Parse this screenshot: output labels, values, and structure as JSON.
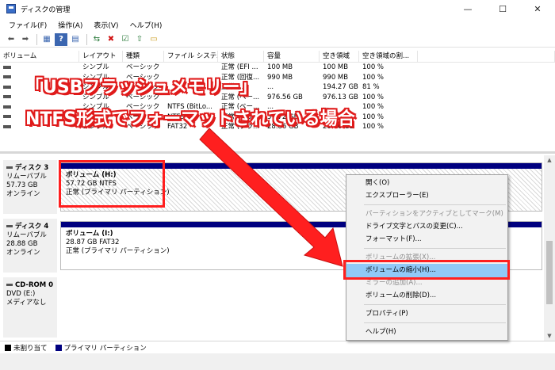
{
  "window": {
    "title": "ディスクの管理",
    "minimize_glyph": "—",
    "maximize_glyph": "☐",
    "close_glyph": "✕"
  },
  "menubar": {
    "items": [
      "ファイル(F)",
      "操作(A)",
      "表示(V)",
      "ヘルプ(H)"
    ]
  },
  "toolbar": {
    "icons": [
      "back-arrow-icon",
      "forward-arrow-icon",
      "console-icon",
      "help-icon",
      "properties-icon",
      "connect-icon",
      "delete-icon",
      "check-icon",
      "folder-up-icon",
      "folder-icon"
    ],
    "glyphs": [
      "⬅",
      "➡",
      "▦",
      "?",
      "▤",
      "⇆",
      "✖",
      "☑",
      "⇧",
      "▭"
    ]
  },
  "volume_table": {
    "headers": [
      "ボリューム",
      "レイアウト",
      "種類",
      "ファイル システム",
      "状態",
      "容量",
      "空き領域",
      "空き領域の割...",
      ""
    ],
    "rows": [
      [
        "",
        "シンプル",
        "ベーシック",
        "",
        "正常 (EFI ...",
        "100 MB",
        "100 MB",
        "100 %",
        ""
      ],
      [
        "",
        "シンプル",
        "ベーシック",
        "",
        "正常 (回復...",
        "990 MB",
        "990 MB",
        "100 %",
        ""
      ],
      [
        "",
        "シンプル",
        "ベーシック",
        "",
        "正常 (...",
        "...",
        "194.27 GB",
        "81 %",
        ""
      ],
      [
        "",
        "シンプル",
        "ベーシック",
        "",
        "正常 (ベー...",
        "976.56 GB",
        "976.13 GB",
        "100 %",
        ""
      ],
      [
        "",
        "シンプル",
        "ベーシック",
        "NTFS (BitLo...",
        "正常 (ベー...",
        "...",
        "...",
        "100 %",
        ""
      ],
      [
        "",
        "シンプル",
        "ベーシック",
        "NTFS",
        "正常 (プラ...",
        "57.72 GB",
        "57.59 GB",
        "100 %",
        ""
      ],
      [
        "",
        "シンプル",
        "ベーシック",
        "FAT32",
        "正常 (プラ...",
        "28.86 GB",
        "28.86 GB",
        "100 %",
        ""
      ]
    ]
  },
  "disks": [
    {
      "label_name": "ディスク 3",
      "label_type": "リムーバブル",
      "label_size": "57.73 GB",
      "label_status": "オンライン",
      "partition_name": "ボリューム (H:)",
      "partition_size": "57.72 GB NTFS",
      "partition_status": "正常 (プライマリ パーティション)"
    },
    {
      "label_name": "ディスク 4",
      "label_type": "リムーバブル",
      "label_size": "28.88 GB",
      "label_status": "オンライン",
      "partition_name": "ボリューム (I:)",
      "partition_size": "28.87 GB FAT32",
      "partition_status": "正常 (プライマリ パーティション)"
    },
    {
      "label_name": "CD-ROM 0",
      "label_type": "DVD (E:)",
      "label_size": "",
      "label_status": "メディアなし"
    }
  ],
  "legend": {
    "items": [
      {
        "label": "未割り当て",
        "color": "#000000"
      },
      {
        "label": "プライマリ パーティション",
        "color": "#00007f"
      }
    ]
  },
  "context_menu": {
    "items": [
      {
        "label": "開く(O)",
        "disabled": false,
        "highlight": false
      },
      {
        "label": "エクスプローラー(E)",
        "disabled": false,
        "highlight": false
      },
      {
        "label": "パーティションをアクティブとしてマーク(M)",
        "disabled": true,
        "highlight": false
      },
      {
        "label": "ドライブ文字とパスの変更(C)...",
        "disabled": false,
        "highlight": false
      },
      {
        "label": "フォーマット(F)...",
        "disabled": false,
        "highlight": false
      },
      {
        "label": "ボリュームの拡張(X)...",
        "disabled": true,
        "highlight": false
      },
      {
        "label": "ボリュームの縮小(H)...",
        "disabled": false,
        "highlight": true
      },
      {
        "label": "ミラーの追加(A)...",
        "disabled": true,
        "highlight": false
      },
      {
        "label": "ボリュームの削除(D)...",
        "disabled": false,
        "highlight": false
      },
      {
        "label": "プロパティ(P)",
        "disabled": false,
        "highlight": false
      },
      {
        "label": "ヘルプ(H)",
        "disabled": false,
        "highlight": false
      }
    ]
  },
  "annotation": {
    "line1": "「USBフラッシュメモリー」",
    "line2": "NTFS形式でフォーマットされている場合",
    "color": "#e01b1b"
  },
  "scrollbar": {
    "up_glyph": "▲",
    "down_glyph": "▼"
  }
}
